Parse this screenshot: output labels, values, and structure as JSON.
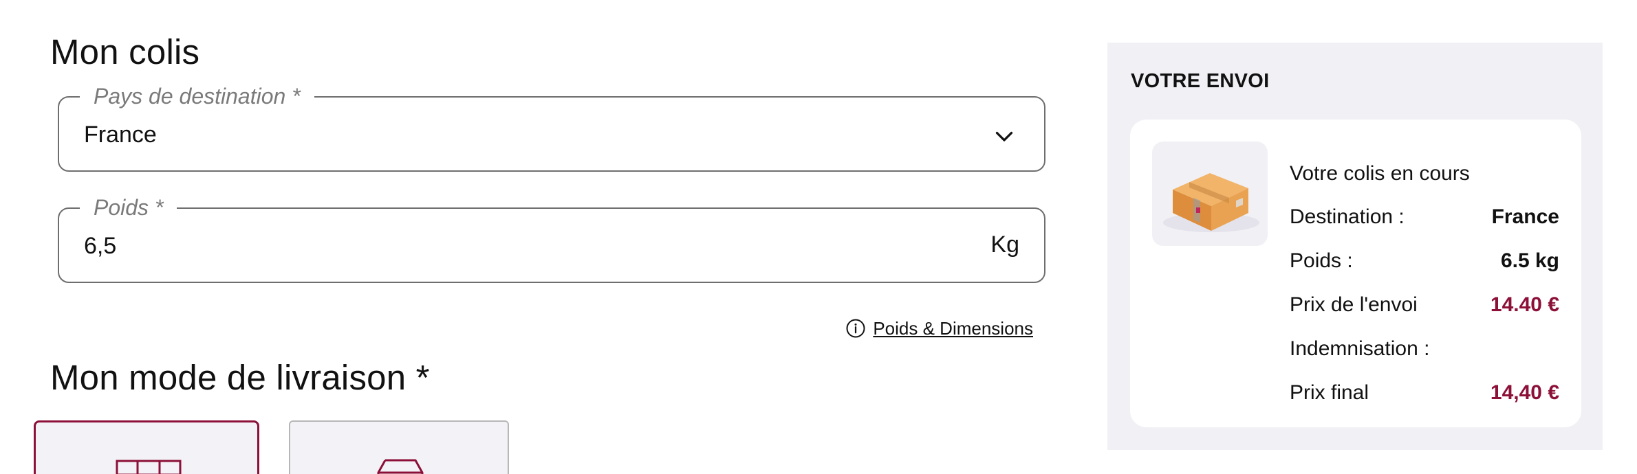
{
  "form": {
    "title": "Mon colis",
    "destination": {
      "label": "Pays de destination *",
      "value": "France"
    },
    "weight": {
      "label": "Poids *",
      "value": "6,5",
      "unit": "Kg"
    },
    "dimensions_link": "Poids & Dimensions",
    "delivery_title": "Mon mode de livraison *"
  },
  "summary": {
    "title": "VOTRE ENVOI",
    "heading": "Votre colis en cours",
    "rows": [
      {
        "label": "Destination :",
        "value": "France"
      },
      {
        "label": "Poids :",
        "value": "6.5 kg"
      },
      {
        "label": "Prix de l'envoi",
        "value": "14.40 €"
      },
      {
        "label": "Indemnisation :",
        "value": ""
      },
      {
        "label": "Prix final",
        "value": "14,40 €"
      }
    ]
  },
  "colors": {
    "accent": "#8c1038",
    "panel_bg": "#f1f0f5",
    "border": "#6e6e6e"
  },
  "icons": [
    "chevron-down-icon",
    "info-icon",
    "package-icon",
    "locker-icon",
    "relay-point-icon"
  ]
}
